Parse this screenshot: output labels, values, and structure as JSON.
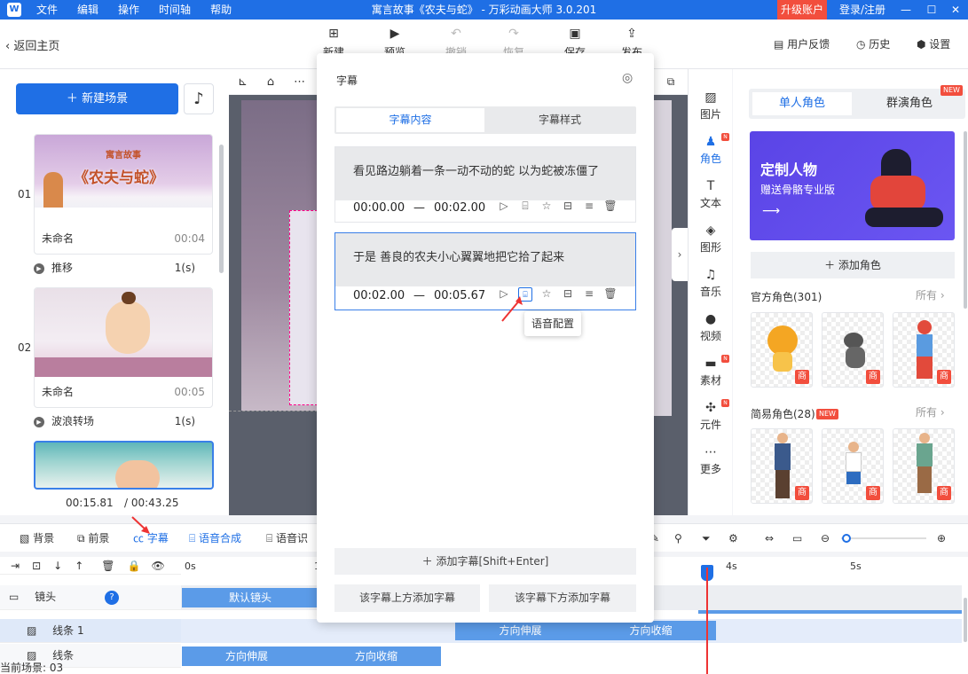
{
  "titlebar": {
    "menu": [
      "文件",
      "编辑",
      "操作",
      "时间轴",
      "帮助"
    ],
    "title": "寓言故事《农夫与蛇》 - 万彩动画大师 3.0.201",
    "upgrade": "升级账户",
    "login": "登录/注册"
  },
  "toolbar": {
    "back": "返回主页",
    "new": "新建",
    "preview": "预览",
    "undo": "撤销",
    "redo": "恢复",
    "save": "保存",
    "publish": "发布",
    "feedback": "用户反馈",
    "history": "历史",
    "settings": "设置"
  },
  "scenes": {
    "new_scene": "新建场景",
    "items": [
      {
        "num": "01",
        "name": "未命名",
        "duration": "00:04",
        "thumb_title_small": "寓言故事",
        "thumb_title": "《农夫与蛇》",
        "transition": "推移",
        "transition_time": "1(s)"
      },
      {
        "num": "02",
        "name": "未命名",
        "duration": "00:05",
        "transition": "波浪转场",
        "transition_time": "1(s)"
      }
    ],
    "time_current": "00:15.81",
    "time_total": "/ 00:43.25"
  },
  "subtitle_panel": {
    "title": "字幕",
    "tab_content": "字幕内容",
    "tab_style": "字幕样式",
    "items": [
      {
        "text": "看见路边躺着一条一动不动的蛇 以为蛇被冻僵了",
        "start": "00:00.00",
        "sep": "—",
        "end": "00:02.00"
      },
      {
        "text": "于是 善良的农夫小心翼翼地把它拾了起来",
        "start": "00:02.00",
        "sep": "—",
        "end": "00:05.67"
      }
    ],
    "tooltip": "语音配置",
    "add": "添加字幕[Shift+Enter]",
    "add_above": "该字幕上方添加字幕",
    "add_below": "该字幕下方添加字幕"
  },
  "right_nav": [
    "图片",
    "角色",
    "文本",
    "图形",
    "音乐",
    "视频",
    "素材",
    "元件",
    "更多"
  ],
  "role_panel": {
    "tab_single": "单人角色",
    "tab_group": "群演角色",
    "new_badge": "NEW",
    "banner_title": "定制人物",
    "banner_sub": "赠送骨骼专业版",
    "add_role": "添加角色",
    "official": "官方角色(301)",
    "simple": "简易角色(28)",
    "more": "所有",
    "shang": "商"
  },
  "bottom_toolbar": {
    "background": "背景",
    "foreground": "前景",
    "subtitle": "字幕",
    "voice": "语音合成",
    "voice2": "语音识"
  },
  "timeline": {
    "ticks": [
      "0s",
      "1",
      "4s",
      "5s"
    ],
    "rows": [
      {
        "name": "镜头",
        "block": "默认镜头"
      },
      {
        "name": "线条 1",
        "blocks": [
          "方向伸展",
          "方向收缩"
        ]
      },
      {
        "name": "线条",
        "blocks": [
          "方向伸展",
          "方向收缩"
        ]
      }
    ],
    "status": "当前场景: 03"
  },
  "colors": {
    "brand": "#1f6fe5",
    "accent_red": "#f24e3d"
  }
}
